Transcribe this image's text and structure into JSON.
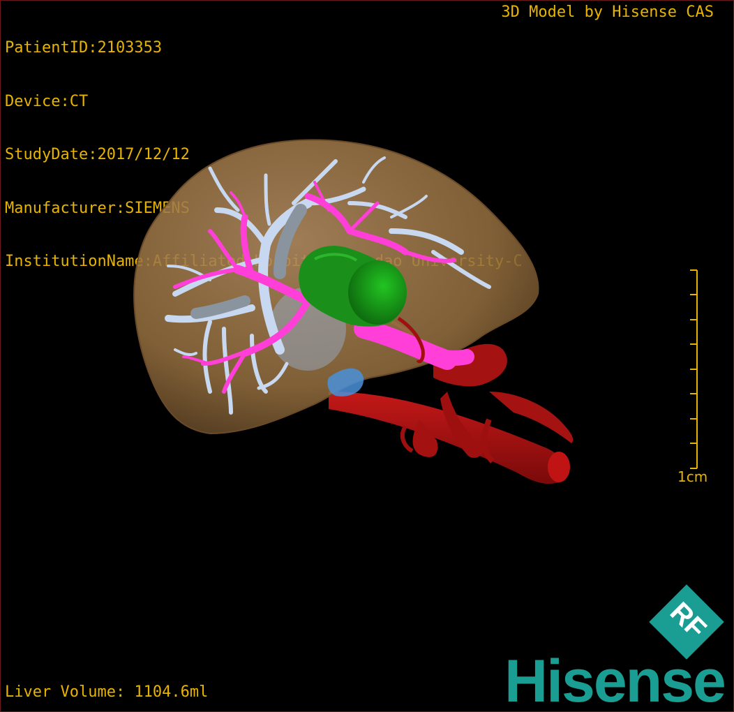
{
  "overlay": {
    "patient_id": "PatientID:2103353",
    "device": "Device:CT",
    "study_date": "StudyDate:2017/12/12",
    "manufacturer": "Manufacturer:SIEMENS",
    "institution": "InstitutionName:Affiliated Hospital Qingdao University-C",
    "credit": "3D Model by Hisense CAS",
    "liver_volume": "Liver Volume: 1104.6ml"
  },
  "scale_bar": {
    "label": "1cm"
  },
  "brand": {
    "logo_mark": "RF",
    "name": "Hisense"
  },
  "colors": {
    "overlay_text": "#e8b400",
    "liver": "#a47c52",
    "portal_vein": "#c8d8f0",
    "hepatic_vein": "#ff3fd8",
    "tumor": "#1fa51f",
    "artery": "#b01010",
    "gallbladder": "#4a90d9",
    "brand": "#1a9e94"
  }
}
